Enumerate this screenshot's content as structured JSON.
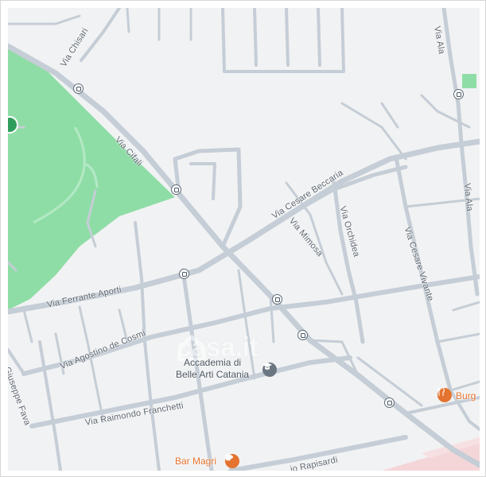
{
  "map": {
    "colors": {
      "background": "#f1f2f3",
      "road": "#c5cdd6",
      "park": "#8fdda6",
      "pink_area": "#f4d6d9",
      "food_accent": "#e4732f",
      "academy_icon": "#6b7683"
    },
    "streets": {
      "via_chisari": "Via Chisari",
      "via_cifali": "Via Cifali",
      "via_ala_top": "Via Ala",
      "via_ala_right": "Via Ala",
      "via_cesare_beccaria": "Via Cesare Beccaria",
      "via_mimosa": "Via Mimosa",
      "via_orchidea": "Via Orchidea",
      "via_cesare_vivante": "Via Cesare Vivante",
      "via_ferrante_aporti": "Via Ferrante Aporti",
      "via_agostino_de_cosmi": "Via Agostino de Cosmi",
      "via_giuseppe_fava": "Giuseppe Fava",
      "via_raimondo_franchetti": "Via Raimondo Franchetti",
      "via_rapisardi": "io Rapisardi"
    },
    "pois": {
      "academy_line1": "Accademia di",
      "academy_line2": "Belle Arti Catania",
      "academy_icon": "graduation-cap-icon",
      "bar_magri": "Bar Magri",
      "bar_magri_icon": "coffee-cup-icon",
      "burger": "Burg",
      "burger_icon": "fork-knife-icon",
      "bus_stop_icon": "bus-stop-icon"
    },
    "watermark": "casa.it"
  }
}
